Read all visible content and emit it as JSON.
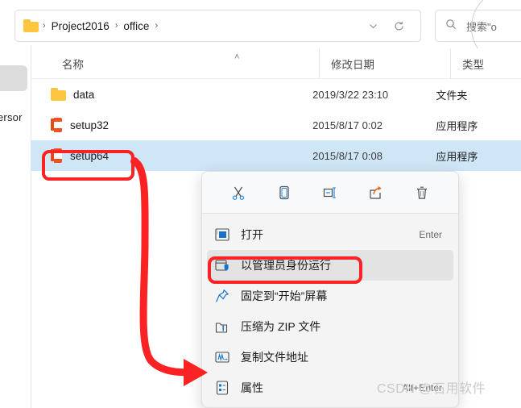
{
  "window": {
    "address": {
      "folder_icon": "folder-icon",
      "crumbs": [
        "Project2016",
        "office"
      ],
      "separator": "›",
      "recent_icon": "chevron-down-icon",
      "refresh_icon": "refresh-icon"
    },
    "search": {
      "icon": "search-icon",
      "text": "搜索\"o"
    }
  },
  "columns": {
    "name": "名称",
    "date": "修改日期",
    "type": "类型",
    "sort_caret": "˄"
  },
  "files": [
    {
      "icon": "folder-icon",
      "name": "data",
      "date": "2019/3/22 23:10",
      "type": "文件夹",
      "selected": false
    },
    {
      "icon": "office-icon",
      "name": "setup32",
      "date": "2015/8/17 0:02",
      "type": "应用程序",
      "selected": false
    },
    {
      "icon": "office-icon",
      "name": "setup64",
      "date": "2015/8/17 0:08",
      "type": "应用程序",
      "selected": true
    }
  ],
  "context_menu": {
    "toolbar": [
      {
        "icon": "cut-icon",
        "label": "剪切"
      },
      {
        "icon": "copy-icon",
        "label": "复制"
      },
      {
        "icon": "rename-icon",
        "label": "重命名"
      },
      {
        "icon": "share-icon",
        "label": "共享"
      },
      {
        "icon": "delete-icon",
        "label": "删除"
      }
    ],
    "items": [
      {
        "icon": "open-icon",
        "label": "打开",
        "shortcut": "Enter",
        "highlighted": false
      },
      {
        "icon": "shield-icon",
        "label": "以管理员身份运行",
        "shortcut": "",
        "highlighted": true
      },
      {
        "icon": "pin-icon",
        "label": "固定到“开始”屏幕",
        "shortcut": "",
        "highlighted": false
      },
      {
        "icon": "zip-icon",
        "label": "压缩为 ZIP 文件",
        "shortcut": "",
        "highlighted": false
      },
      {
        "icon": "copypath-icon",
        "label": "复制文件地址",
        "shortcut": "",
        "highlighted": false
      },
      {
        "icon": "properties-icon",
        "label": "属性",
        "shortcut": "Alt+Enter",
        "highlighted": false
      }
    ]
  },
  "sidebar": {
    "fragment_text": "ersor"
  },
  "watermark": "CSDN @石用软件",
  "colors": {
    "annotation_red": "#fa2222",
    "selection_blue": "#cfe6f7",
    "menu_bg": "#f4f4f4",
    "office_orange": "#f25022",
    "folder_yellow": "#fcc63f"
  }
}
